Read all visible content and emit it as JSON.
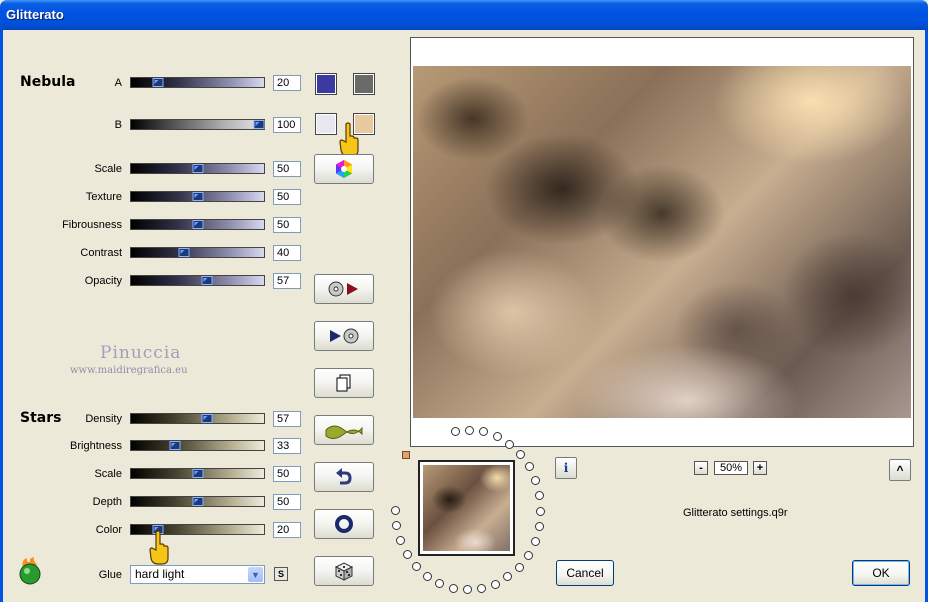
{
  "window": {
    "title": "Glitterato"
  },
  "nebula": {
    "heading": "Nebula",
    "sliders": [
      {
        "label": "A",
        "value": "20"
      },
      {
        "label": "B",
        "value": "100"
      },
      {
        "label": "Scale",
        "value": "50"
      },
      {
        "label": "Texture",
        "value": "50"
      },
      {
        "label": "Fibrousness",
        "value": "50"
      },
      {
        "label": "Contrast",
        "value": "40"
      },
      {
        "label": "Opacity",
        "value": "57"
      }
    ],
    "colors": [
      "#3a3aa0",
      "#6a6a6a",
      "#e8e8f0",
      "#e8c8a0"
    ]
  },
  "watermark": {
    "name": "Pinuccia",
    "url": "www.maidiregrafica.eu"
  },
  "stars": {
    "heading": "Stars",
    "sliders": [
      {
        "label": "Density",
        "value": "57"
      },
      {
        "label": "Brightness",
        "value": "33"
      },
      {
        "label": "Scale",
        "value": "50"
      },
      {
        "label": "Depth",
        "value": "50"
      },
      {
        "label": "Color",
        "value": "20"
      }
    ],
    "glue_label": "Glue",
    "glue_value": "hard light",
    "s_button": "S"
  },
  "preview": {
    "zoom": "50%",
    "settings_file": "Glitterato settings.q9r"
  },
  "buttons": {
    "cancel": "Cancel",
    "ok": "OK",
    "minus": "-",
    "plus": "+",
    "up": "^",
    "info": "i"
  }
}
